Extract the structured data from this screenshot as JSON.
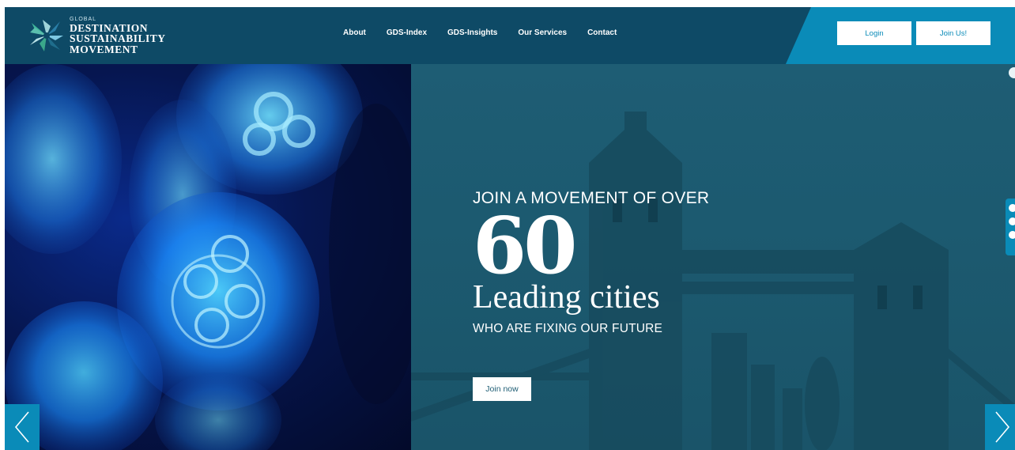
{
  "brand": {
    "small": "GLOBAL",
    "line1": "DESTINATION",
    "line2": "SUSTAINABILITY",
    "line3": "MOVEMENT"
  },
  "nav": {
    "items": [
      {
        "label": "About"
      },
      {
        "label": "GDS-Index"
      },
      {
        "label": "GDS-Insights"
      },
      {
        "label": "Our Services"
      },
      {
        "label": "Contact"
      }
    ]
  },
  "header_buttons": {
    "login": "Login",
    "join": "Join Us!"
  },
  "hero": {
    "kicker": "JOIN A MOVEMENT OF OVER",
    "number": "60",
    "headline": "Leading cities",
    "subline": "WHO ARE FIXING OUR FUTURE",
    "cta": "Join now"
  },
  "colors": {
    "header": "#0e4a66",
    "accent": "#0a8bb8",
    "overlay": "#1e5d74"
  },
  "icons": {
    "prev": "chevron-left-icon",
    "next": "chevron-right-icon",
    "social": [
      "facebook-icon",
      "twitter-icon",
      "instagram-icon"
    ]
  }
}
